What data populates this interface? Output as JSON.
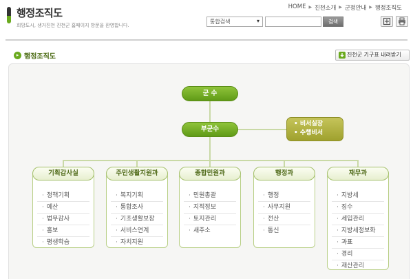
{
  "header": {
    "title": "행정조직도",
    "subtitle": "희망도시, 생거진천 진천군 홈페이지 방문을 환영합니다."
  },
  "breadcrumb": [
    "HOME",
    "진천소개",
    "군정안내",
    "행정조직도"
  ],
  "search": {
    "select_value": "통합검색",
    "button_label": "검색"
  },
  "section": {
    "title": "행정조직도",
    "download_label": "진천군 기구표 내려받기"
  },
  "org": {
    "top": "군 수",
    "deputy": "부군수",
    "secretary": [
      "비서실장",
      "수행비서"
    ],
    "departments": [
      {
        "name": "기획감사실",
        "items": [
          "정책기획",
          "예산",
          "법무감사",
          "홍보",
          "평생학습"
        ]
      },
      {
        "name": "주민생활지원과",
        "items": [
          "복지기획",
          "통합조사",
          "기초생활보장",
          "서비스연계",
          "자치지원"
        ]
      },
      {
        "name": "종합민원과",
        "items": [
          "민원총괄",
          "지적정보",
          "토지관리",
          "새주소"
        ]
      },
      {
        "name": "행정과",
        "items": [
          "행정",
          "사무지원",
          "전산",
          "통신"
        ]
      },
      {
        "name": "재무과",
        "items": [
          "지방세",
          "징수",
          "세입관리",
          "지방세정보화",
          "과표",
          "경리",
          "재산관리"
        ]
      }
    ]
  },
  "icons": [
    "view-mode-icon",
    "print-icon",
    "download-icon",
    "chevron-right-icon"
  ],
  "colors": {
    "accent_green": "#6aaa1e",
    "secretary_olive": "#a3a432",
    "panel_bg": "#f6f6f4"
  }
}
